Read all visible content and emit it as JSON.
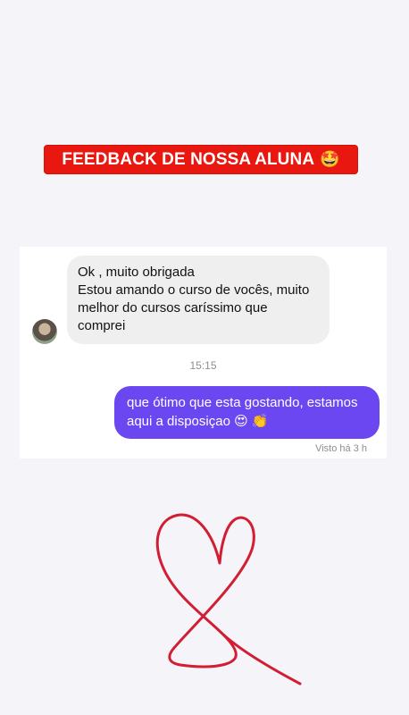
{
  "banner": {
    "text": "FEEDBACK DE NOSSA ALUNA",
    "emoji": "🤩"
  },
  "chat": {
    "incoming": {
      "line1": "Ok , muito obrigada",
      "line2": "Estou amando o curso de vocês, muito melhor do cursos caríssimo que comprei"
    },
    "timestamp": "15:15",
    "outgoing": {
      "text": "que ótimo que esta gostando, estamos aqui a disposiçao 😍 👏"
    },
    "seen_status": "Visto há 3 h"
  },
  "colors": {
    "banner_red": "#e8170f",
    "outgoing_bubble": "#6b47f2",
    "incoming_bubble": "#efefef",
    "heart_red": "#d21e32"
  },
  "icons": {
    "avatar": "user-avatar",
    "drawing": "hand-drawn-heart"
  }
}
